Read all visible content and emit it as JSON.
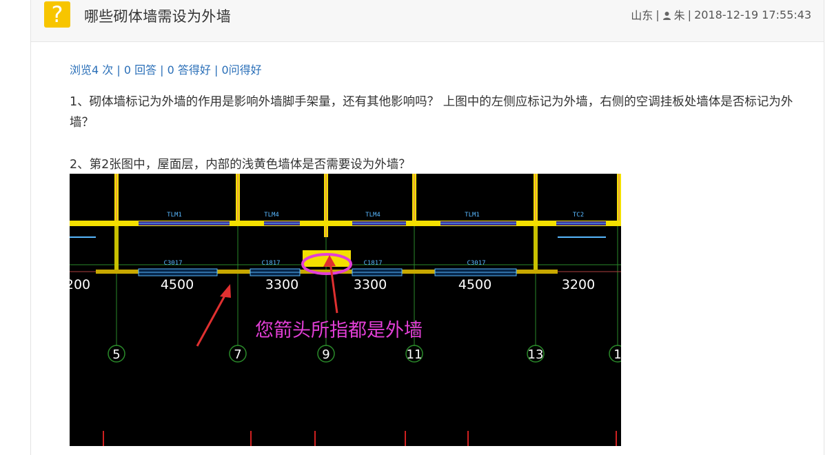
{
  "question": {
    "icon_glyph": "?",
    "title": "哪些砌体墙需设为外墙",
    "location": "山东",
    "user": "朱",
    "datetime": "2018-12-19 17:55:43"
  },
  "stats": "浏览4 次 | 0 回答 | 0 答得好 | 0问得好",
  "paragraphs": [
    "1、砌体墙标记为外墙的作用是影响外墙脚手架量，还有其他影响吗？ 上图中的左侧应标记为外墙，右侧的空调挂板处墙体是否标记为外墙？",
    "2、第2张图中，屋面层，内部的浅黄色墙体是否需要设为外墙？"
  ],
  "drawing": {
    "top_labels": [
      "TLM1",
      "TLM4",
      "TLM4",
      "TLM1",
      "TC2"
    ],
    "window_labels": [
      "C3017",
      "C1817",
      "C1817",
      "C3017"
    ],
    "dimensions": [
      "200",
      "4500",
      "3300",
      "3300",
      "4500",
      "3200"
    ],
    "axis_numbers": [
      "5",
      "7",
      "9",
      "11",
      "13",
      "1"
    ],
    "annotation": "您箭头所指都是外墙",
    "annotation_color": "#e23fd6",
    "wall_color": "#f4e000",
    "grid_color": "#2a8a2a",
    "window_color": "#58b8ff"
  }
}
